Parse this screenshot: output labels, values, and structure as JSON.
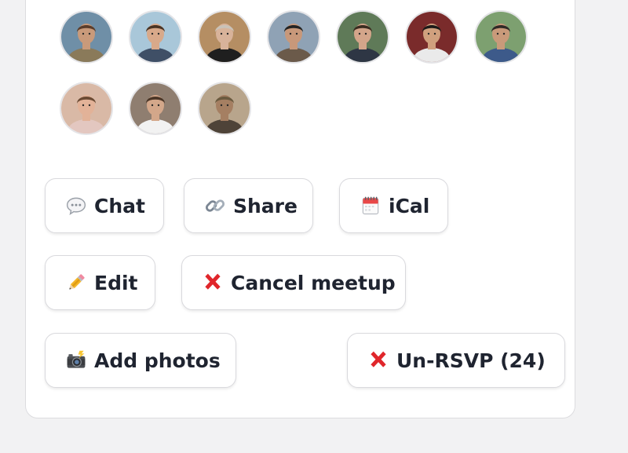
{
  "attendees": [
    {
      "name": "attendee-1",
      "bg": "#6f8fa7",
      "skin": "#c99a7a",
      "hair": "#5a3d2b",
      "shirt": "#8a7a5a"
    },
    {
      "name": "attendee-2",
      "bg": "#a9c7d9",
      "skin": "#d8a98a",
      "hair": "#4a3424",
      "shirt": "#3f4f66"
    },
    {
      "name": "attendee-3",
      "bg": "#b58e63",
      "skin": "#d8b39a",
      "hair": "#c9c2b8",
      "shirt": "#1f1f1f"
    },
    {
      "name": "attendee-4",
      "bg": "#8fa2b5",
      "skin": "#c8987a",
      "hair": "#232323",
      "shirt": "#6b5a4a"
    },
    {
      "name": "attendee-5",
      "bg": "#5f7a58",
      "skin": "#d3a58a",
      "hair": "#3a2c20",
      "shirt": "#2e3644"
    },
    {
      "name": "attendee-6",
      "bg": "#7a2b2b",
      "skin": "#d0a07e",
      "hair": "#1c1a18",
      "shirt": "#eaeaea"
    },
    {
      "name": "attendee-7",
      "bg": "#7da070",
      "skin": "#c99a7a",
      "hair": "#2f2a26",
      "shirt": "#3d5a8a"
    },
    {
      "name": "attendee-8",
      "bg": "#d9b9a6",
      "skin": "#e2b298",
      "hair": "#6a4a33",
      "shirt": "#e3c7c0"
    },
    {
      "name": "attendee-9",
      "bg": "#8f7e70",
      "skin": "#d3a78a",
      "hair": "#4a3526",
      "shirt": "#f2f2f2"
    },
    {
      "name": "attendee-10",
      "bg": "#b8a58c",
      "skin": "#a57f62",
      "hair": "#6a5a3f",
      "shirt": "#4e4338"
    }
  ],
  "actions": {
    "chat": "Chat",
    "share": "Share",
    "ical": "iCal",
    "edit": "Edit",
    "cancel_meetup": "Cancel meetup",
    "add_photos": "Add photos",
    "un_rsvp": "Un-RSVP (24)"
  },
  "icons": {
    "chat": "speech-bubble-icon",
    "share": "link-icon",
    "ical": "calendar-icon",
    "edit": "pencil-icon",
    "cancel": "cross-mark-icon",
    "photos": "camera-flash-icon"
  },
  "colors": {
    "cross_red": "#e0262b",
    "text": "#1f2430",
    "border": "#d9d9dd"
  }
}
